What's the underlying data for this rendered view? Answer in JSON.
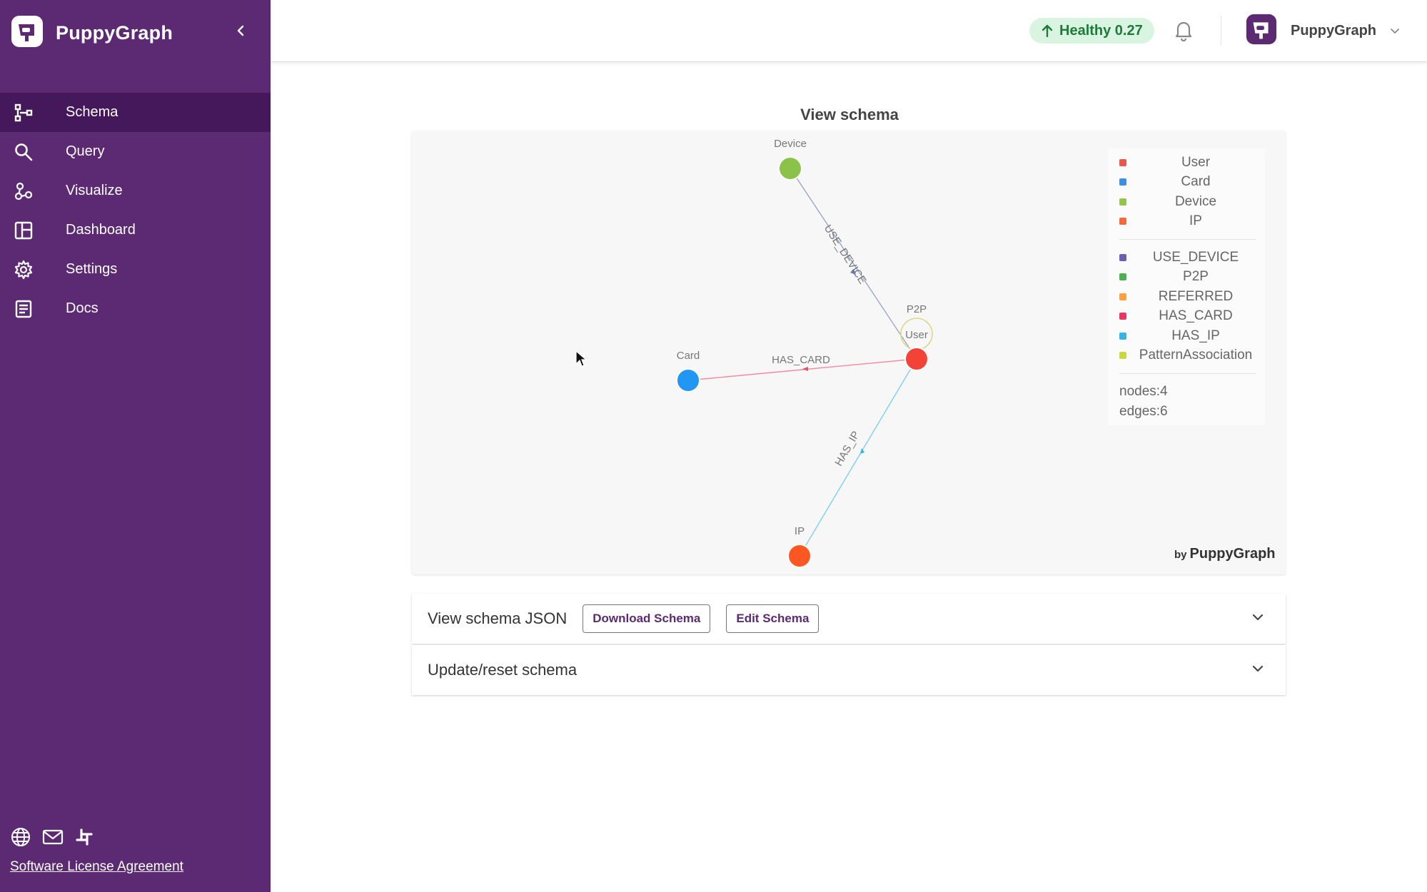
{
  "app": {
    "name": "PuppyGraph"
  },
  "sidebar": {
    "items": [
      {
        "label": "Schema",
        "icon": "schema-icon",
        "active": true
      },
      {
        "label": "Query",
        "icon": "search-icon"
      },
      {
        "label": "Visualize",
        "icon": "visualize-icon"
      },
      {
        "label": "Dashboard",
        "icon": "dashboard-icon"
      },
      {
        "label": "Settings",
        "icon": "gear-icon"
      },
      {
        "label": "Docs",
        "icon": "docs-icon"
      }
    ],
    "bottom_icons": [
      "globe-icon",
      "mail-icon",
      "slack-icon"
    ],
    "license_link": "Software License Agreement"
  },
  "header": {
    "health": "Healthy 0.27",
    "account_name": "PuppyGraph"
  },
  "schema": {
    "title": "View schema",
    "nodes": [
      {
        "label": "Device",
        "color": "#8bc34a"
      },
      {
        "label": "User",
        "color": "#f44336"
      },
      {
        "label": "Card",
        "color": "#2196f3"
      },
      {
        "label": "IP",
        "color": "#ff5722"
      }
    ],
    "edges": [
      {
        "label": "USE_DEVICE",
        "from": "User",
        "to": "Device",
        "color": "#9fa6c8"
      },
      {
        "label": "P2P",
        "from": "User",
        "to": "User",
        "color": "#d9d98a"
      },
      {
        "label": "HAS_CARD",
        "from": "User",
        "to": "Card",
        "color": "#f08aa0"
      },
      {
        "label": "HAS_IP",
        "from": "User",
        "to": "IP",
        "color": "#7fcfe8"
      }
    ],
    "legend": {
      "node_types": [
        {
          "label": "User",
          "color": "#e8574b"
        },
        {
          "label": "Card",
          "color": "#3d8fe0"
        },
        {
          "label": "Device",
          "color": "#93c54b"
        },
        {
          "label": "IP",
          "color": "#f26a3d"
        }
      ],
      "edge_types": [
        {
          "label": "USE_DEVICE",
          "color": "#6a5fb0"
        },
        {
          "label": "P2P",
          "color": "#4caf50"
        },
        {
          "label": "REFERRED",
          "color": "#ff9f40"
        },
        {
          "label": "HAS_CARD",
          "color": "#e53964"
        },
        {
          "label": "HAS_IP",
          "color": "#36b4e5"
        },
        {
          "label": "PatternAssociation",
          "color": "#c9d740"
        }
      ],
      "nodes_count": "nodes:4",
      "edges_count": "edges:6"
    },
    "byline_prefix": "by",
    "byline_brand": "PuppyGraph"
  },
  "panels": {
    "json_title": "View schema JSON",
    "download_label": "Download Schema",
    "edit_label": "Edit Schema",
    "update_title": "Update/reset schema"
  }
}
